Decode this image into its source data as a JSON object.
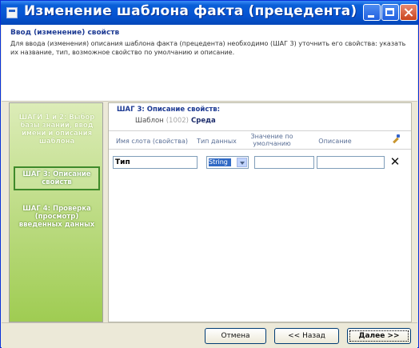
{
  "window": {
    "title": "Изменение шаблона факта (прецедента)"
  },
  "header": {
    "title": "Ввод (изменение) свойств",
    "description": "Для ввода (изменения) описания шаблона факта (прецедента) необходимо (ШАГ 3) уточнить его свойства: указать их название, тип, возможное свойство по умолчанию и описание."
  },
  "sidebar": {
    "steps": [
      {
        "label": "ШАГИ 1 и 2: Выбор базы знаний, ввод имени и описания шаблона"
      },
      {
        "label": "ШАГ 3: Описание свойств"
      },
      {
        "label": "ШАГ 4: Проверка (просмотр) введенных данных"
      }
    ]
  },
  "content": {
    "section_title": "ШАГ 3: Описание свойств:",
    "template_label": "Шаблон",
    "template_code": "(1002)",
    "template_name": "Среда",
    "columns": {
      "name": "Имя слота (свойства)",
      "type": "Тип данных",
      "default": "Значение по умолчанию",
      "description": "Описание"
    },
    "rows": [
      {
        "name": "Тип",
        "type": "String",
        "default": "",
        "description": ""
      }
    ]
  },
  "footer": {
    "cancel": "Отмена",
    "back": "<< Назад",
    "next": "Далее >>"
  }
}
